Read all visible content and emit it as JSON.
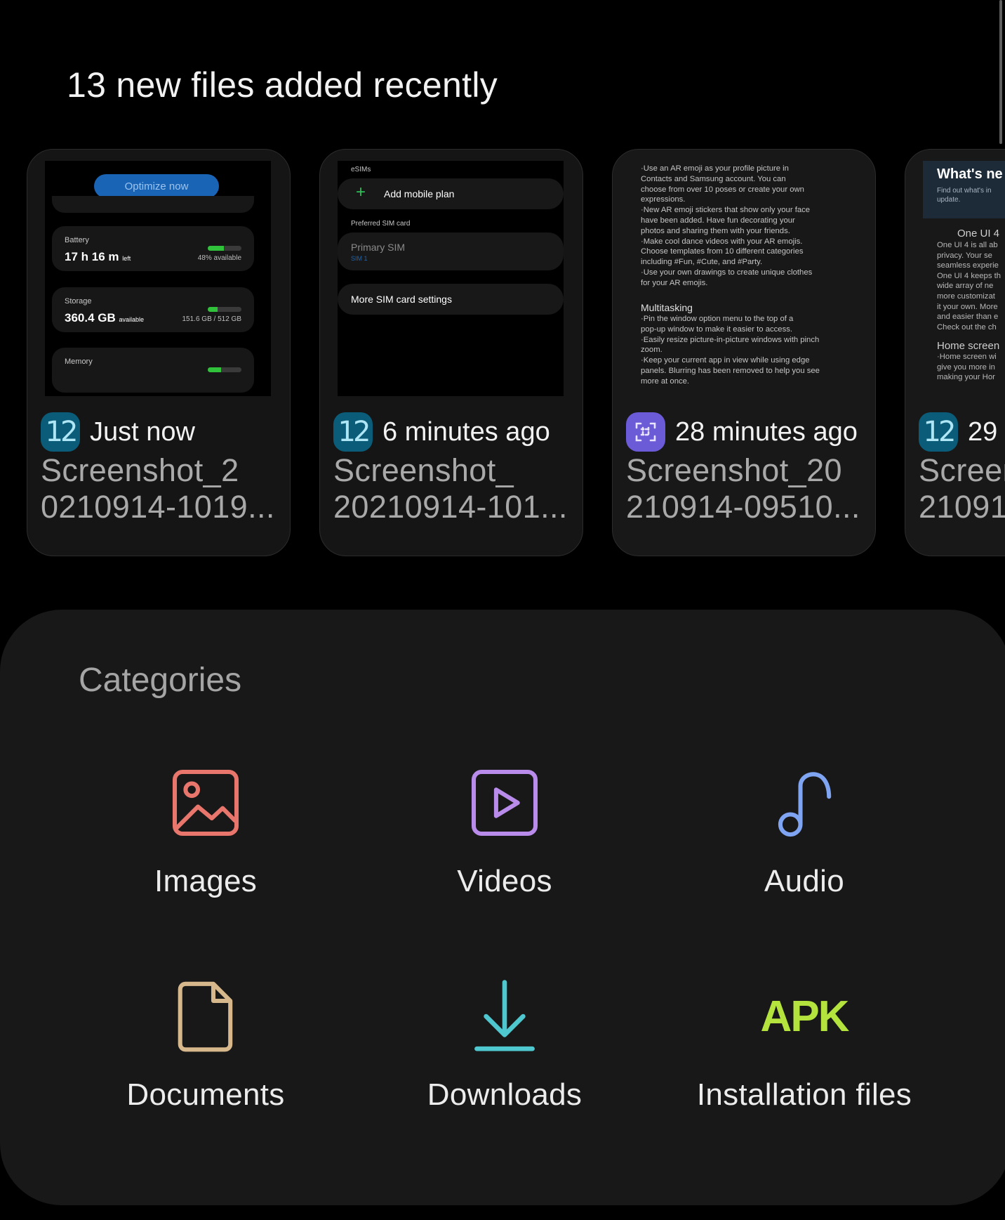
{
  "recent": {
    "title": "13 new files added recently",
    "cards": [
      {
        "time": "Just now",
        "name_line1": "Screenshot_2",
        "name_line2": "0210914-1019...",
        "badge": "12"
      },
      {
        "time": "6 minutes ago",
        "name_line1": "Screenshot_",
        "name_line2": "20210914-101...",
        "badge": "12"
      },
      {
        "time": "28 minutes ago",
        "name_line1": "Screenshot_20",
        "name_line2": "210914-09510...",
        "badge": "screen-capture-icon"
      },
      {
        "time": "29",
        "name_line1": "Screen",
        "name_line2": "21091",
        "badge": "12"
      }
    ]
  },
  "thumb1": {
    "optimize": "Optimize now",
    "battery_label": "Battery",
    "battery_value": "17 h 16 m",
    "battery_unit": "left",
    "battery_sub": "48% available",
    "battery_level": 0.48,
    "storage_label": "Storage",
    "storage_value": "360.4 GB",
    "storage_unit": "available",
    "storage_sub": "151.6 GB / 512 GB",
    "storage_level": 0.3,
    "memory_label": "Memory",
    "memory_level": 0.4
  },
  "thumb2": {
    "esims": "eSIMs",
    "add_plan": "Add mobile plan",
    "preferred": "Preferred SIM card",
    "primary": "Primary SIM",
    "sim1": "SIM 1",
    "more": "More SIM card settings"
  },
  "thumb3": {
    "body1": "·Use an AR emoji as your profile picture in\n Contacts and Samsung account. You can\n choose from over 10 poses or create your own\n expressions.\n·New AR emoji stickers that show only your face\n have been added. Have fun decorating your\n photos and sharing them with your friends.\n·Make cool dance videos with your AR emojis.\n Choose templates from 10 different categories\n including #Fun, #Cute, and #Party.\n·Use your own drawings to create unique clothes\n for your AR emojis.",
    "heading": "Multitasking",
    "body2": "·Pin the window option menu to the top of a\n pop-up window to make it easier to access.\n·Easily resize picture-in-picture windows with pinch\n zoom.\n·Keep your current app in view while using edge\n panels. Blurring has been removed to help you see\n more at once."
  },
  "thumb4": {
    "title": "What's ne",
    "subtitle": "Find out what's in\nupdate.",
    "sec1": "One UI 4",
    "body1": "One UI 4 is all ab\nprivacy. Your se\nseamless experie\nOne UI 4 keeps th\nwide array of ne\nmore customizat\nit your own. More\nand easier than e\nCheck out the ch",
    "sec2": "Home screen",
    "body2": "·Home screen wi\n give you more in\n making your Hor"
  },
  "categories": {
    "title": "Categories",
    "items": [
      {
        "label": "Images",
        "icon": "image-icon",
        "color": "#e8766c"
      },
      {
        "label": "Videos",
        "icon": "video-icon",
        "color": "#b98bea"
      },
      {
        "label": "Audio",
        "icon": "music-note-icon",
        "color": "#7ea4f2"
      },
      {
        "label": "Documents",
        "icon": "document-icon",
        "color": "#d7b88c"
      },
      {
        "label": "Downloads",
        "icon": "download-icon",
        "color": "#4ec7cf"
      },
      {
        "label": "Installation files",
        "icon": "apk-icon",
        "icon_text": "APK",
        "color": "#b3e33c"
      }
    ]
  }
}
